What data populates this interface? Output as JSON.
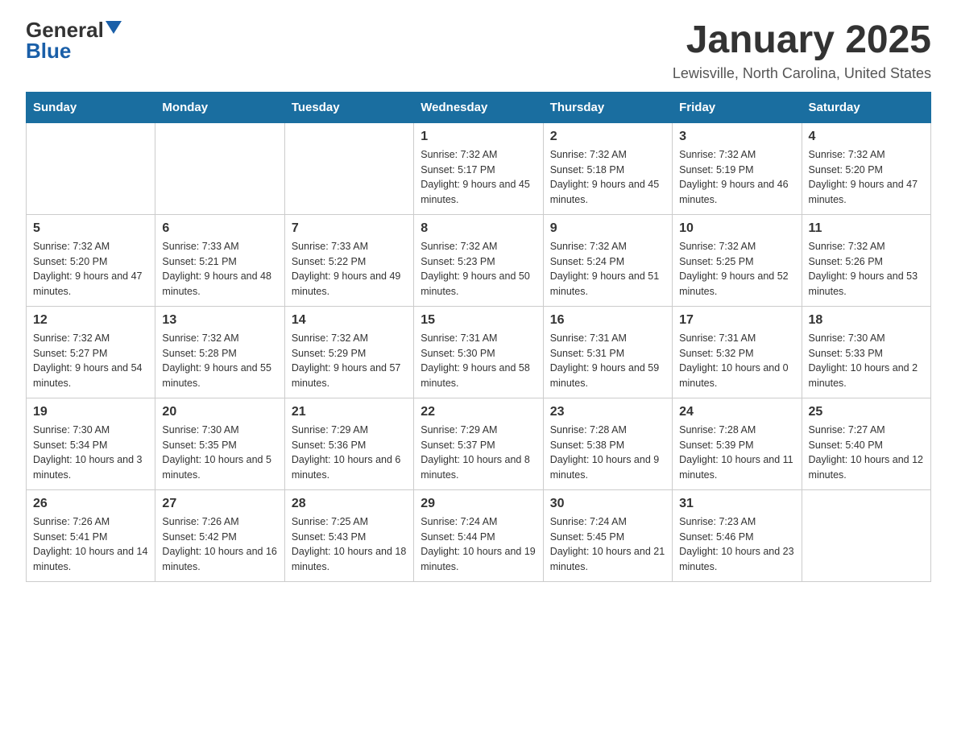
{
  "header": {
    "logo_general": "General",
    "logo_blue": "Blue",
    "main_title": "January 2025",
    "subtitle": "Lewisville, North Carolina, United States"
  },
  "weekdays": [
    "Sunday",
    "Monday",
    "Tuesday",
    "Wednesday",
    "Thursday",
    "Friday",
    "Saturday"
  ],
  "weeks": [
    [
      {
        "day": "",
        "info": ""
      },
      {
        "day": "",
        "info": ""
      },
      {
        "day": "",
        "info": ""
      },
      {
        "day": "1",
        "info": "Sunrise: 7:32 AM\nSunset: 5:17 PM\nDaylight: 9 hours and 45 minutes."
      },
      {
        "day": "2",
        "info": "Sunrise: 7:32 AM\nSunset: 5:18 PM\nDaylight: 9 hours and 45 minutes."
      },
      {
        "day": "3",
        "info": "Sunrise: 7:32 AM\nSunset: 5:19 PM\nDaylight: 9 hours and 46 minutes."
      },
      {
        "day": "4",
        "info": "Sunrise: 7:32 AM\nSunset: 5:20 PM\nDaylight: 9 hours and 47 minutes."
      }
    ],
    [
      {
        "day": "5",
        "info": "Sunrise: 7:32 AM\nSunset: 5:20 PM\nDaylight: 9 hours and 47 minutes."
      },
      {
        "day": "6",
        "info": "Sunrise: 7:33 AM\nSunset: 5:21 PM\nDaylight: 9 hours and 48 minutes."
      },
      {
        "day": "7",
        "info": "Sunrise: 7:33 AM\nSunset: 5:22 PM\nDaylight: 9 hours and 49 minutes."
      },
      {
        "day": "8",
        "info": "Sunrise: 7:32 AM\nSunset: 5:23 PM\nDaylight: 9 hours and 50 minutes."
      },
      {
        "day": "9",
        "info": "Sunrise: 7:32 AM\nSunset: 5:24 PM\nDaylight: 9 hours and 51 minutes."
      },
      {
        "day": "10",
        "info": "Sunrise: 7:32 AM\nSunset: 5:25 PM\nDaylight: 9 hours and 52 minutes."
      },
      {
        "day": "11",
        "info": "Sunrise: 7:32 AM\nSunset: 5:26 PM\nDaylight: 9 hours and 53 minutes."
      }
    ],
    [
      {
        "day": "12",
        "info": "Sunrise: 7:32 AM\nSunset: 5:27 PM\nDaylight: 9 hours and 54 minutes."
      },
      {
        "day": "13",
        "info": "Sunrise: 7:32 AM\nSunset: 5:28 PM\nDaylight: 9 hours and 55 minutes."
      },
      {
        "day": "14",
        "info": "Sunrise: 7:32 AM\nSunset: 5:29 PM\nDaylight: 9 hours and 57 minutes."
      },
      {
        "day": "15",
        "info": "Sunrise: 7:31 AM\nSunset: 5:30 PM\nDaylight: 9 hours and 58 minutes."
      },
      {
        "day": "16",
        "info": "Sunrise: 7:31 AM\nSunset: 5:31 PM\nDaylight: 9 hours and 59 minutes."
      },
      {
        "day": "17",
        "info": "Sunrise: 7:31 AM\nSunset: 5:32 PM\nDaylight: 10 hours and 0 minutes."
      },
      {
        "day": "18",
        "info": "Sunrise: 7:30 AM\nSunset: 5:33 PM\nDaylight: 10 hours and 2 minutes."
      }
    ],
    [
      {
        "day": "19",
        "info": "Sunrise: 7:30 AM\nSunset: 5:34 PM\nDaylight: 10 hours and 3 minutes."
      },
      {
        "day": "20",
        "info": "Sunrise: 7:30 AM\nSunset: 5:35 PM\nDaylight: 10 hours and 5 minutes."
      },
      {
        "day": "21",
        "info": "Sunrise: 7:29 AM\nSunset: 5:36 PM\nDaylight: 10 hours and 6 minutes."
      },
      {
        "day": "22",
        "info": "Sunrise: 7:29 AM\nSunset: 5:37 PM\nDaylight: 10 hours and 8 minutes."
      },
      {
        "day": "23",
        "info": "Sunrise: 7:28 AM\nSunset: 5:38 PM\nDaylight: 10 hours and 9 minutes."
      },
      {
        "day": "24",
        "info": "Sunrise: 7:28 AM\nSunset: 5:39 PM\nDaylight: 10 hours and 11 minutes."
      },
      {
        "day": "25",
        "info": "Sunrise: 7:27 AM\nSunset: 5:40 PM\nDaylight: 10 hours and 12 minutes."
      }
    ],
    [
      {
        "day": "26",
        "info": "Sunrise: 7:26 AM\nSunset: 5:41 PM\nDaylight: 10 hours and 14 minutes."
      },
      {
        "day": "27",
        "info": "Sunrise: 7:26 AM\nSunset: 5:42 PM\nDaylight: 10 hours and 16 minutes."
      },
      {
        "day": "28",
        "info": "Sunrise: 7:25 AM\nSunset: 5:43 PM\nDaylight: 10 hours and 18 minutes."
      },
      {
        "day": "29",
        "info": "Sunrise: 7:24 AM\nSunset: 5:44 PM\nDaylight: 10 hours and 19 minutes."
      },
      {
        "day": "30",
        "info": "Sunrise: 7:24 AM\nSunset: 5:45 PM\nDaylight: 10 hours and 21 minutes."
      },
      {
        "day": "31",
        "info": "Sunrise: 7:23 AM\nSunset: 5:46 PM\nDaylight: 10 hours and 23 minutes."
      },
      {
        "day": "",
        "info": ""
      }
    ]
  ]
}
